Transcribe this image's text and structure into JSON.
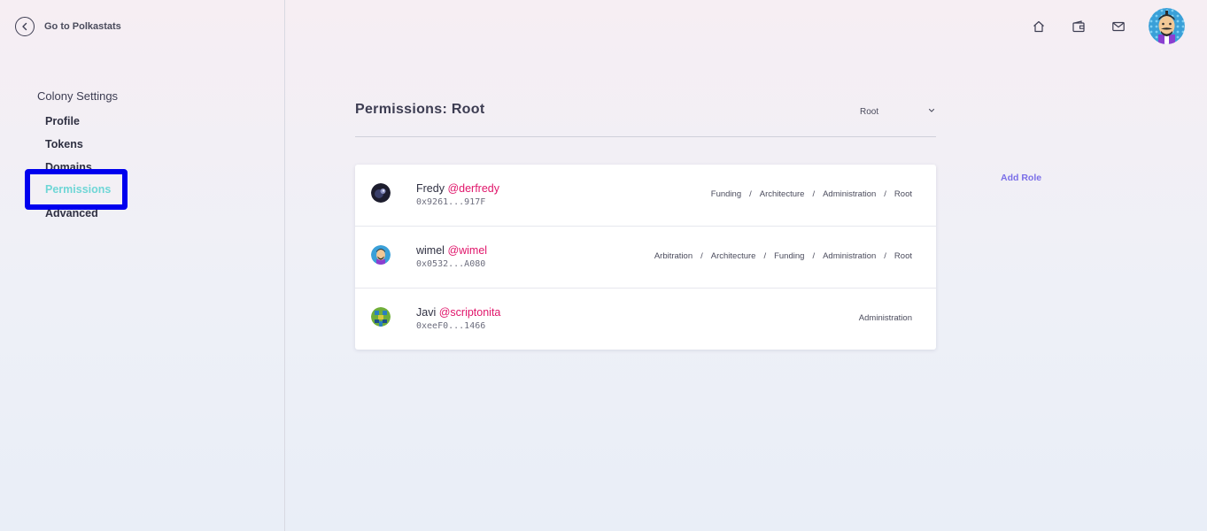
{
  "sidebar": {
    "back_label": "Go to Polkastats",
    "settings_title": "Colony Settings",
    "items": [
      {
        "label": "Profile",
        "id": "profile"
      },
      {
        "label": "Tokens",
        "id": "tokens"
      },
      {
        "label": "Domains",
        "id": "domains"
      },
      {
        "label": "Permissions",
        "id": "permissions",
        "active": true
      },
      {
        "label": "Advanced",
        "id": "advanced"
      }
    ]
  },
  "header_icons": [
    "home-icon",
    "wallet-icon",
    "inbox-icon"
  ],
  "main": {
    "title": "Permissions: Root",
    "domain_select_value": "Root",
    "add_role_label": "Add Role",
    "users": [
      {
        "name": "Fredy",
        "handle": "@derfredy",
        "address": "0x9261...917F",
        "roles": [
          "Funding",
          "Architecture",
          "Administration",
          "Root"
        ]
      },
      {
        "name": "wimel",
        "handle": "@wimel",
        "address": "0x0532...A080",
        "roles": [
          "Arbitration",
          "Architecture",
          "Funding",
          "Administration",
          "Root"
        ]
      },
      {
        "name": "Javi",
        "handle": "@scriptonita",
        "address": "0xeeF0...1466",
        "roles": [
          "Administration"
        ]
      }
    ]
  },
  "colors": {
    "active_nav": "#6fd6d6",
    "handle": "#e0156a",
    "add_role": "#7a6ee8",
    "highlight_border": "#0000ee"
  }
}
